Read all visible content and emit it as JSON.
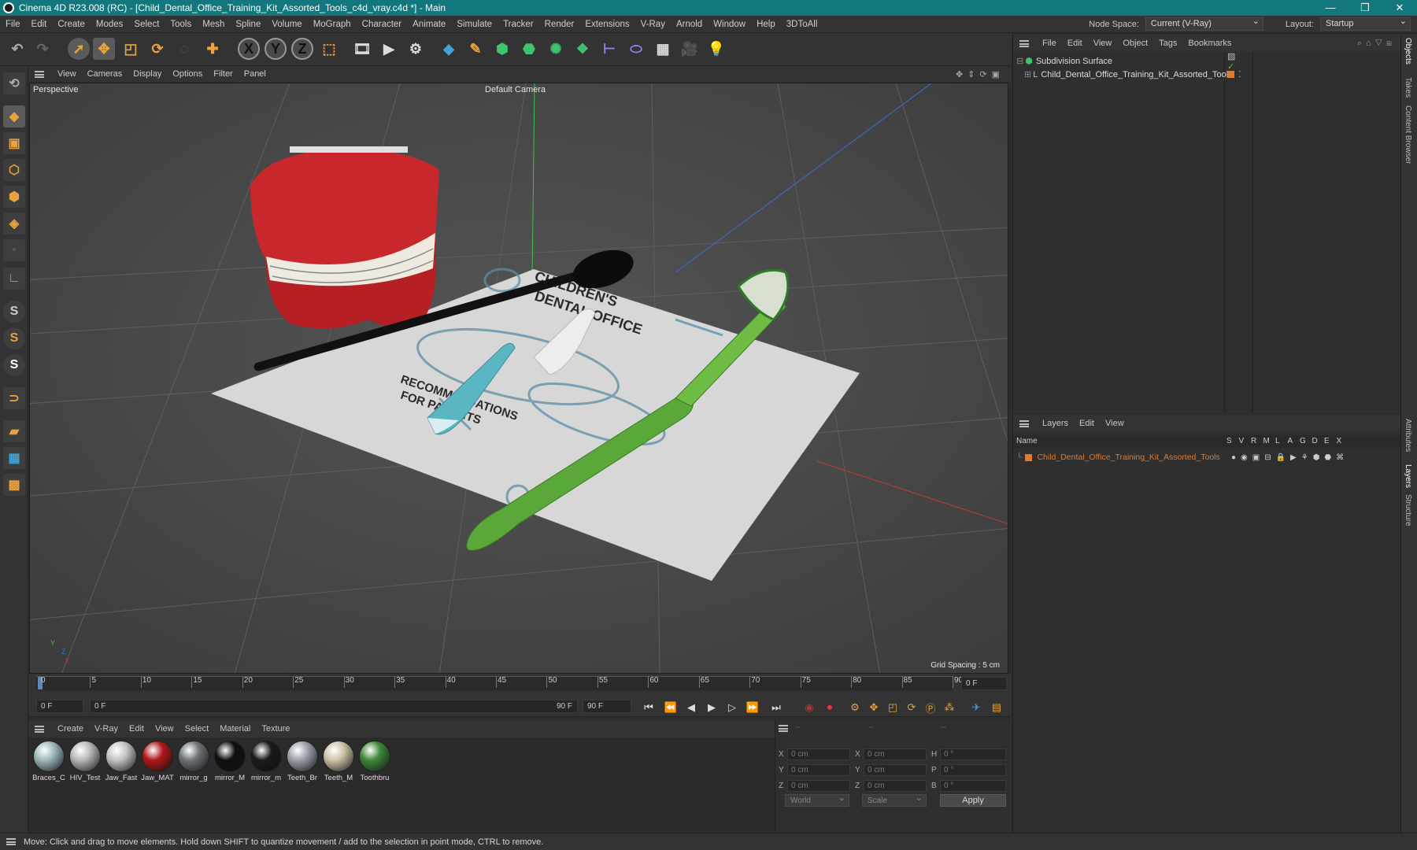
{
  "window": {
    "title": "Cinema 4D R23.008 (RC) - [Child_Dental_Office_Training_Kit_Assorted_Tools_c4d_vray.c4d *] - Main",
    "controls": [
      "—",
      "❐",
      "✕"
    ]
  },
  "menubar": {
    "items": [
      "File",
      "Edit",
      "Create",
      "Modes",
      "Select",
      "Tools",
      "Mesh",
      "Spline",
      "Volume",
      "MoGraph",
      "Character",
      "Animate",
      "Simulate",
      "Tracker",
      "Render",
      "Extensions",
      "V-Ray",
      "Arnold",
      "Window",
      "Help",
      "3DToAll"
    ],
    "node_space_label": "Node Space:",
    "node_space_value": "Current (V-Ray)",
    "layout_label": "Layout:",
    "layout_value": "Startup"
  },
  "viewport": {
    "menu": [
      "View",
      "Cameras",
      "Display",
      "Options",
      "Filter",
      "Panel"
    ],
    "label": "Perspective",
    "camera": "Default Camera",
    "grid_spacing": "Grid Spacing : 5 cm",
    "axis_y": "Y",
    "axis_z": "Z",
    "axis_x": "X"
  },
  "timeline": {
    "ticks": [
      "0",
      "5",
      "10",
      "15",
      "20",
      "25",
      "30",
      "35",
      "40",
      "45",
      "50",
      "55",
      "60",
      "65",
      "70",
      "75",
      "80",
      "85",
      "90"
    ],
    "current_frame": "0 F"
  },
  "playbar": {
    "start": "0 F",
    "range_start": "0 F",
    "range_end": "90 F",
    "end": "90 F"
  },
  "materials": {
    "menu": [
      "Create",
      "V-Ray",
      "Edit",
      "View",
      "Select",
      "Material",
      "Texture"
    ],
    "items": [
      {
        "name": "Braces_C",
        "color": "#9fb9bd"
      },
      {
        "name": "HIV_Test",
        "color": "#b8b8b8"
      },
      {
        "name": "Jaw_Fast",
        "color": "#c4c4c4"
      },
      {
        "name": "Jaw_MAT",
        "color": "#b01818"
      },
      {
        "name": "mirror_g",
        "color": "#6d747a"
      },
      {
        "name": "mirror_M",
        "color": "#101010"
      },
      {
        "name": "mirror_m",
        "color": "#1a1a1a"
      },
      {
        "name": "Teeth_Br",
        "color": "#9aa2aa"
      },
      {
        "name": "Teeth_M",
        "color": "#cfc4a8"
      },
      {
        "name": "Toothbru",
        "color": "#3f8a3a"
      }
    ]
  },
  "coordinates": {
    "headers": [
      "--",
      "--",
      "--"
    ],
    "rows": [
      {
        "a": "X",
        "av": "0 cm",
        "b": "X",
        "bv": "0 cm",
        "c": "H",
        "cv": "0 °"
      },
      {
        "a": "Y",
        "av": "0 cm",
        "b": "Y",
        "bv": "0 cm",
        "c": "P",
        "cv": "0 °"
      },
      {
        "a": "Z",
        "av": "0 cm",
        "b": "Z",
        "bv": "0 cm",
        "c": "B",
        "cv": "0 °"
      }
    ],
    "mode": "World",
    "scale": "Scale",
    "apply": "Apply"
  },
  "objects": {
    "menu": [
      "File",
      "Edit",
      "View",
      "Object",
      "Tags",
      "Bookmarks"
    ],
    "items": [
      {
        "name": "Subdivision Surface"
      },
      {
        "name": "Child_Dental_Office_Training_Kit_Assorted_Tools"
      }
    ]
  },
  "layers": {
    "menu": [
      "Layers",
      "Edit",
      "View"
    ],
    "header_name": "Name",
    "header_flags": [
      "S",
      "V",
      "R",
      "M",
      "L",
      "A",
      "G",
      "D",
      "E",
      "X"
    ],
    "items": [
      {
        "name": "Child_Dental_Office_Training_Kit_Assorted_Tools",
        "color": "#e07a2e"
      }
    ]
  },
  "right_tabs": [
    "Objects",
    "Takes",
    "Content Browser",
    "Attributes",
    "Layers",
    "Structure"
  ],
  "status": "Move: Click and drag to move elements. Hold down SHIFT to quantize movement / add to the selection in point mode, CTRL to remove.",
  "colors": {
    "titlebar": "#13787e",
    "accent": "#e07a2e",
    "toolbar_icon": "#3fa2d8"
  }
}
